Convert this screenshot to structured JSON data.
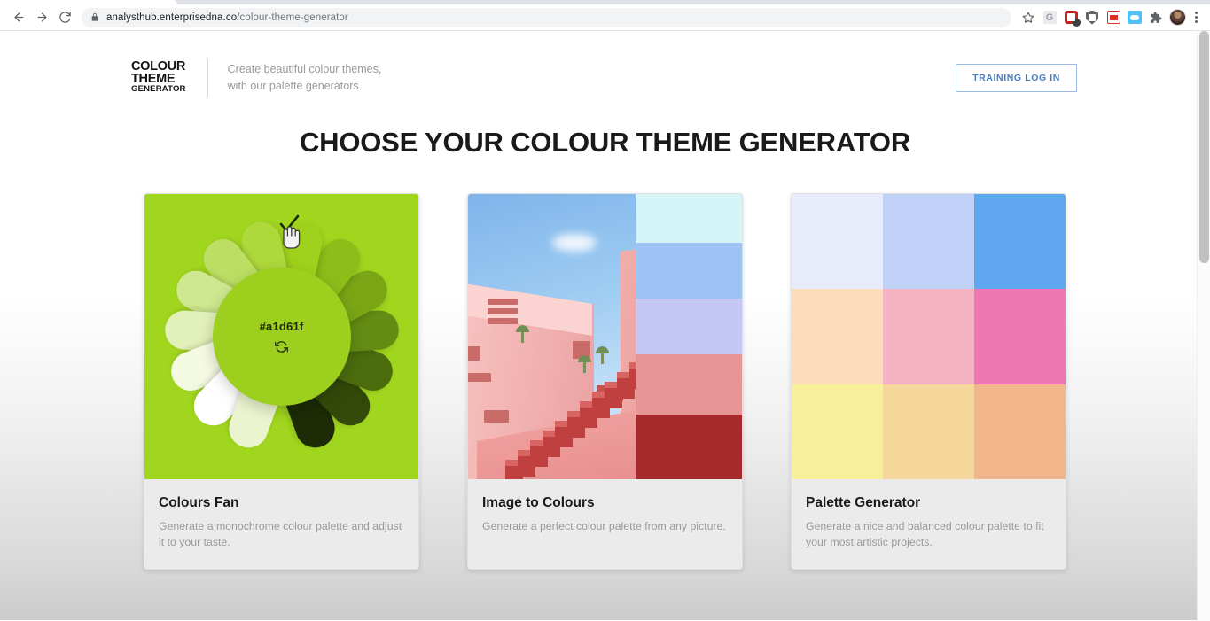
{
  "browser": {
    "back_icon": "back-arrow-icon",
    "forward_icon": "forward-arrow-icon",
    "reload_icon": "reload-icon",
    "lock_icon": "lock-icon",
    "url_host": "analysthub.enterprisedna.co",
    "url_path": "/colour-theme-generator",
    "bookmark_icon": "star-icon",
    "extensions": [
      {
        "name": "grammarly-extension-icon"
      },
      {
        "name": "lastpass-extension-icon"
      },
      {
        "name": "shield-extension-icon"
      },
      {
        "name": "toolbox-extension-icon"
      },
      {
        "name": "cloud-extension-icon"
      },
      {
        "name": "puzzle-extensions-icon"
      }
    ],
    "avatar_icon": "profile-avatar",
    "menu_icon": "kebab-menu-icon"
  },
  "site": {
    "logo": {
      "line1": "COLOUR",
      "line2": "THEME",
      "line3": "GENERATOR"
    },
    "tagline_line1": "Create beautiful colour themes,",
    "tagline_line2": "with our palette generators.",
    "login_button": "TRAINING LOG IN",
    "page_title": "CHOOSE YOUR COLOUR THEME GENERATOR"
  },
  "cards": [
    {
      "title": "Colours Fan",
      "description": "Generate a monochrome colour palette and adjust it to your taste.",
      "media": "colours-fan-preview",
      "hex_value": "#a1d61f",
      "refresh_icon": "refresh-icon",
      "cursor_icon": "pointer-hand-with-check-icon",
      "base_colour": "#a1d61f",
      "petal_colours": [
        "#eaf4cf",
        "#ffffff",
        "#f4f9e2",
        "#e2f0b9",
        "#cfe88f",
        "#bcdf63",
        "#aed93b",
        "#9ed11c",
        "#8cbd19",
        "#7aa616",
        "#638c12",
        "#4b6d0e",
        "#33490a",
        "#1d2b06"
      ]
    },
    {
      "title": "Image to Colours",
      "description": "Generate a perfect colour palette from any picture.",
      "media": "image-to-colours-preview",
      "swatch_colours": [
        "#d4f4f7",
        "#9dc4f5",
        "#c5c8f4",
        "#e79695",
        "#a52a2c"
      ]
    },
    {
      "title": "Palette Generator",
      "description": "Generate a nice and balanced colour palette to fit your most artistic projects.",
      "media": "palette-generator-preview",
      "grid_colours": [
        "#e8ebfa",
        "#c0d1f7",
        "#5fa8f0",
        "#fbddb9",
        "#f4b2c2",
        "#ef77b4",
        "#f7ef9a",
        "#f6d79b",
        "#f1b68c"
      ]
    }
  ]
}
